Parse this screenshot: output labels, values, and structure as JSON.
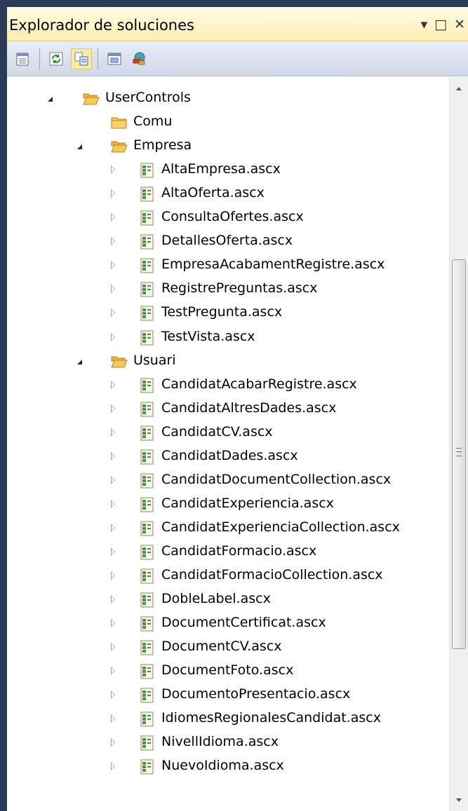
{
  "window": {
    "title": "Explorador de soluciones",
    "controls": [
      "▾",
      "□",
      "✕"
    ]
  },
  "toolbar": {
    "buttons": [
      {
        "icon": "properties-icon"
      },
      {
        "icon": "refresh-icon"
      },
      {
        "icon": "show-all-files-icon",
        "pressed": true
      },
      {
        "icon": "view-designer-icon"
      },
      {
        "icon": "web-config-icon"
      }
    ]
  },
  "tree": {
    "items": [
      {
        "label": "UserControls",
        "kind": "folder-open",
        "state": "expanded",
        "level": 0
      },
      {
        "label": "Comu",
        "kind": "folder",
        "state": "none",
        "level": 1
      },
      {
        "label": "Empresa",
        "kind": "folder-open",
        "state": "expanded",
        "level": 1
      },
      {
        "label": "AltaEmpresa.ascx",
        "kind": "ascx",
        "state": "collapsed",
        "level": 2
      },
      {
        "label": "AltaOferta.ascx",
        "kind": "ascx",
        "state": "collapsed",
        "level": 2
      },
      {
        "label": "ConsultaOfertes.ascx",
        "kind": "ascx",
        "state": "collapsed",
        "level": 2
      },
      {
        "label": "DetallesOferta.ascx",
        "kind": "ascx",
        "state": "collapsed",
        "level": 2
      },
      {
        "label": "EmpresaAcabamentRegistre.ascx",
        "kind": "ascx",
        "state": "collapsed",
        "level": 2
      },
      {
        "label": "RegistrePreguntas.ascx",
        "kind": "ascx",
        "state": "collapsed",
        "level": 2
      },
      {
        "label": "TestPregunta.ascx",
        "kind": "ascx",
        "state": "collapsed",
        "level": 2
      },
      {
        "label": "TestVista.ascx",
        "kind": "ascx",
        "state": "collapsed",
        "level": 2
      },
      {
        "label": "Usuari",
        "kind": "folder-open",
        "state": "expanded",
        "level": 1
      },
      {
        "label": "CandidatAcabarRegistre.ascx",
        "kind": "ascx",
        "state": "collapsed",
        "level": 2
      },
      {
        "label": "CandidatAltresDades.ascx",
        "kind": "ascx",
        "state": "collapsed",
        "level": 2
      },
      {
        "label": "CandidatCV.ascx",
        "kind": "ascx",
        "state": "collapsed",
        "level": 2
      },
      {
        "label": "CandidatDades.ascx",
        "kind": "ascx",
        "state": "collapsed",
        "level": 2
      },
      {
        "label": "CandidatDocumentCollection.ascx",
        "kind": "ascx",
        "state": "collapsed",
        "level": 2
      },
      {
        "label": "CandidatExperiencia.ascx",
        "kind": "ascx",
        "state": "collapsed",
        "level": 2
      },
      {
        "label": "CandidatExperienciaCollection.ascx",
        "kind": "ascx",
        "state": "collapsed",
        "level": 2
      },
      {
        "label": "CandidatFormacio.ascx",
        "kind": "ascx",
        "state": "collapsed",
        "level": 2
      },
      {
        "label": "CandidatFormacioCollection.ascx",
        "kind": "ascx",
        "state": "collapsed",
        "level": 2
      },
      {
        "label": "DobleLabel.ascx",
        "kind": "ascx",
        "state": "collapsed",
        "level": 2
      },
      {
        "label": "DocumentCertificat.ascx",
        "kind": "ascx",
        "state": "collapsed",
        "level": 2
      },
      {
        "label": "DocumentCV.ascx",
        "kind": "ascx",
        "state": "collapsed",
        "level": 2
      },
      {
        "label": "DocumentFoto.ascx",
        "kind": "ascx",
        "state": "collapsed",
        "level": 2
      },
      {
        "label": "DocumentoPresentacio.ascx",
        "kind": "ascx",
        "state": "collapsed",
        "level": 2
      },
      {
        "label": "IdiomesRegionalesCandidat.ascx",
        "kind": "ascx",
        "state": "collapsed",
        "level": 2
      },
      {
        "label": "NivellIdioma.ascx",
        "kind": "ascx",
        "state": "collapsed",
        "level": 2
      },
      {
        "label": "NuevoIdioma.ascx",
        "kind": "ascx",
        "state": "collapsed",
        "level": 2
      }
    ]
  },
  "colors": {
    "title_bar": "#fdeeb3",
    "frame": "#2b3c59",
    "folder": "#f3c95a",
    "ascx_icon": "#3f9b3f"
  }
}
